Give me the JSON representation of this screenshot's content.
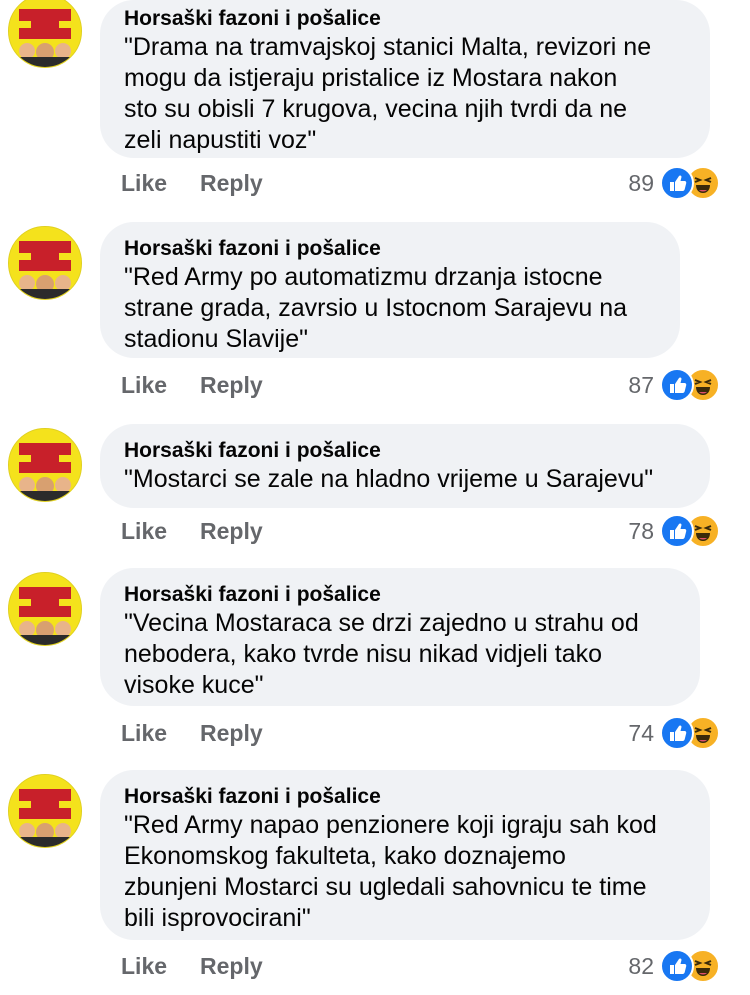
{
  "comments": [
    {
      "author": "Horsaški fazoni i pošalice",
      "text": "\"Drama na tramvajskoj stanici Malta, revizori ne\nmogu da istjeraju pristalice iz Mostara nakon\nsto su obisli 7 krugova, vecina njih tvrdi da ne\nzeli napustiti voz\"",
      "like_label": "Like",
      "reply_label": "Reply",
      "reaction_count": "89"
    },
    {
      "author": "Horsaški fazoni i pošalice",
      "text": "\"Red Army po automatizmu drzanja istocne\nstrane grada, zavrsio u Istocnom Sarajevu na\nstadionu Slavije\"",
      "like_label": "Like",
      "reply_label": "Reply",
      "reaction_count": "87"
    },
    {
      "author": "Horsaški fazoni i pošalice",
      "text": "\"Mostarci se zale na hladno vrijeme u Sarajevu\"",
      "like_label": "Like",
      "reply_label": "Reply",
      "reaction_count": "78"
    },
    {
      "author": "Horsaški fazoni i pošalice",
      "text": "\"Vecina Mostaraca se drzi zajedno u strahu od\nnebodera, kako tvrde nisu nikad vidjeli tako\nvisoke kuce\"",
      "like_label": "Like",
      "reply_label": "Reply",
      "reaction_count": "74"
    },
    {
      "author": "Horsaški fazoni i pošalice",
      "text": "\"Red Army napao penzionere koji igraju sah kod\nEkonomskog fakulteta, kako doznajemo\nzbunjeni Mostarci su ugledali sahovnicu te time\nbili isprovocirani\"",
      "like_label": "Like",
      "reply_label": "Reply",
      "reaction_count": "82"
    }
  ],
  "avatar_logo_text": [
    "ONLY FOOLS",
    "and",
    "HORSES"
  ],
  "icons": {
    "like_reaction": "thumbs-up-icon",
    "haha_reaction": "laughing-face-icon"
  },
  "colors": {
    "bubble": "#f0f2f5",
    "action_text": "#65676b",
    "like_blue": "#1877f2",
    "haha_yellow": "#f7b125",
    "avatar_yellow": "#f4e21c"
  }
}
